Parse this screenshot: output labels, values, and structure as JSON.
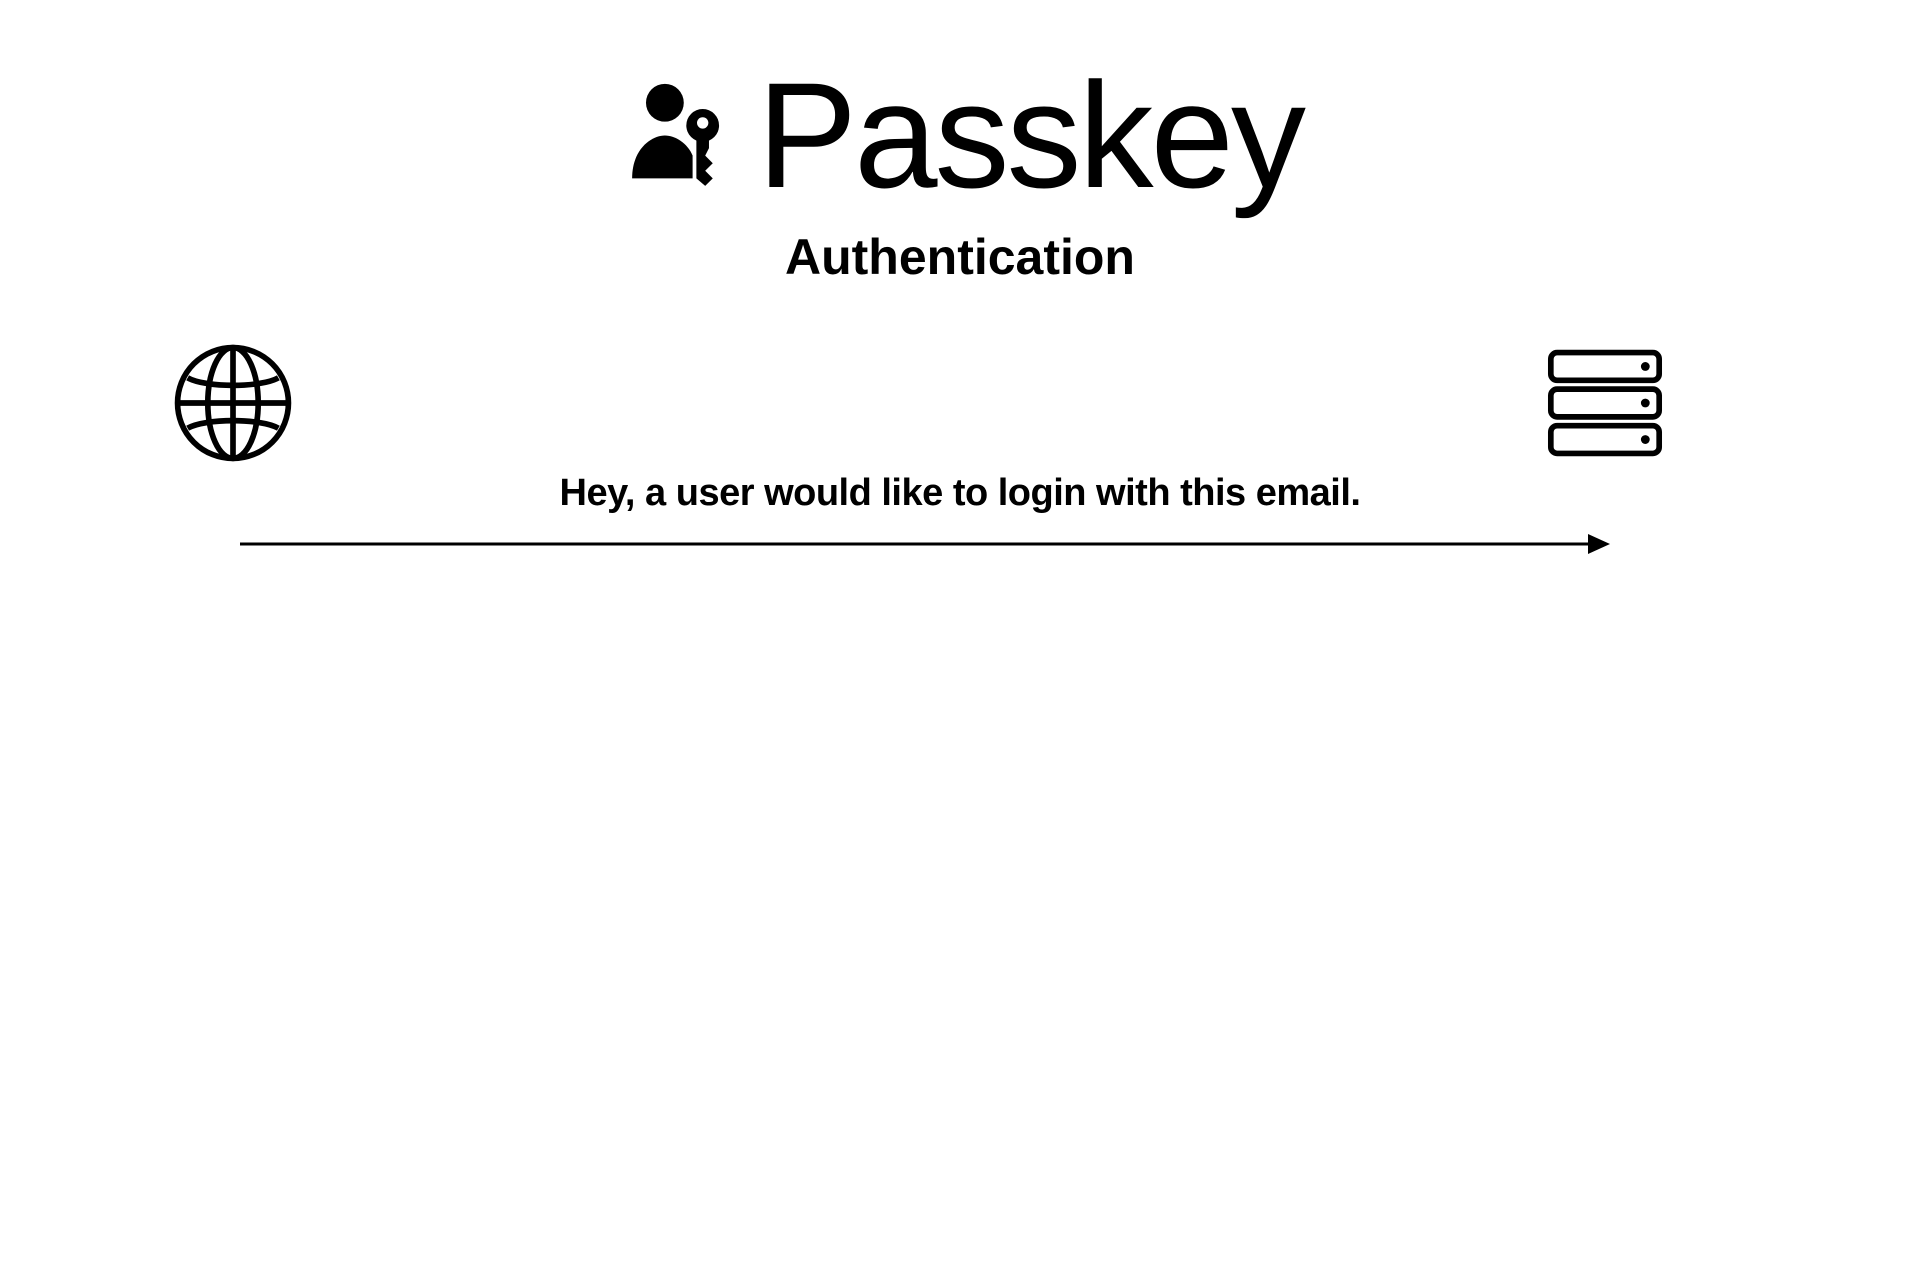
{
  "header": {
    "title": "Passkey",
    "subtitle": "Authentication"
  },
  "flow": {
    "step1_label": "Hey, a user would like to login with this email."
  }
}
